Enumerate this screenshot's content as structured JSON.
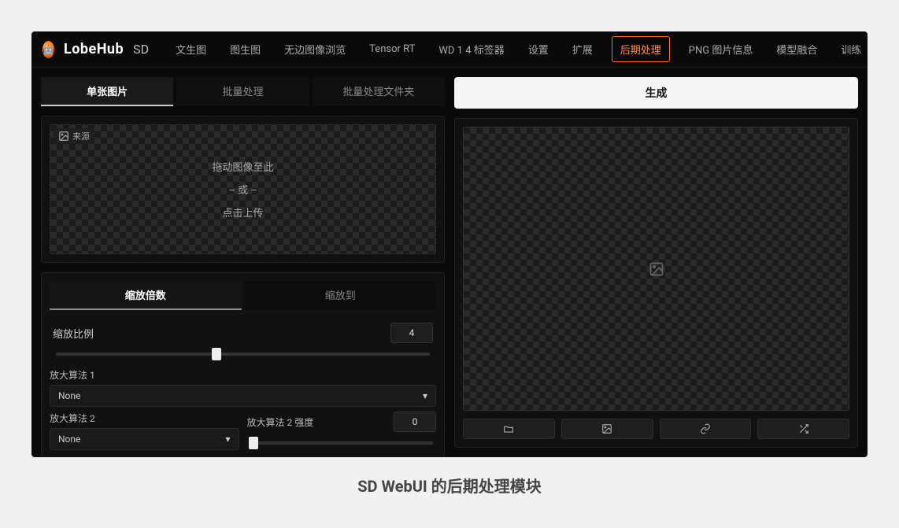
{
  "header": {
    "brand": "LobeHub",
    "sub_brand": "SD",
    "nav": [
      "文生图",
      "图生图",
      "无边图像浏览",
      "Tensor RT",
      "WD 1 4 标签器",
      "设置",
      "扩展",
      "后期处理",
      "PNG 图片信息",
      "模型融合",
      "训练"
    ],
    "active_nav": "后期处理",
    "more": "⋯"
  },
  "left": {
    "input_tabs": [
      "单张图片",
      "批量处理",
      "批量处理文件夹"
    ],
    "active_input_tab": "单张图片",
    "dropzone": {
      "tag": "来源",
      "line1": "拖动图像至此",
      "line2": "– 或 –",
      "line3": "点击上传"
    },
    "scale_tabs": [
      "缩放倍数",
      "缩放到"
    ],
    "active_scale_tab": "缩放倍数",
    "scale_ratio": {
      "label": "缩放比例",
      "value": "4",
      "thumb_pct": 43
    },
    "upscaler1": {
      "label": "放大算法 1",
      "value": "None"
    },
    "upscaler2": {
      "label": "放大算法 2",
      "value": "None"
    },
    "upscaler2_strength": {
      "label": "放大算法 2 强度",
      "value": "0",
      "thumb_pct": 2
    }
  },
  "right": {
    "generate": "生成",
    "actions": [
      "folder",
      "image",
      "link",
      "shuffle"
    ]
  },
  "caption": "SD WebUI 的后期处理模块"
}
